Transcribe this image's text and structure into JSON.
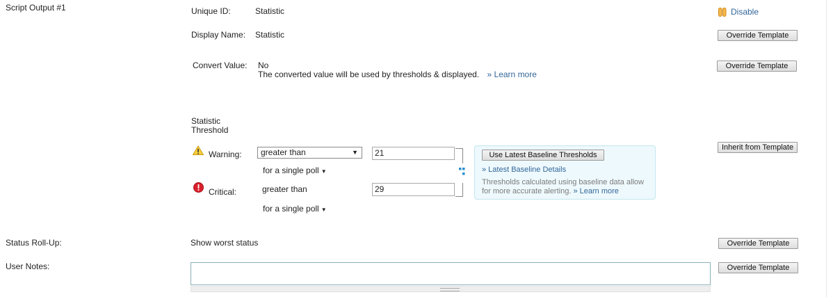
{
  "section_title": "Script Output #1",
  "unique_id": {
    "label": "Unique ID:",
    "value": "Statistic"
  },
  "display_name": {
    "label": "Display Name:",
    "value": "Statistic"
  },
  "convert_value": {
    "label": "Convert Value:",
    "value": "No",
    "description": "The converted value will be used by thresholds & displayed.",
    "learn_more": "» Learn more"
  },
  "disable_label": "Disable",
  "buttons": {
    "override_template": "Override Template",
    "inherit_from_template": "Inherit from Template",
    "use_baseline": "Use Latest Baseline Thresholds"
  },
  "threshold": {
    "title_line1": "Statistic",
    "title_line2": "Threshold",
    "warning": {
      "label": "Warning:",
      "operator": "greater than",
      "value": "21",
      "poll": "for a single poll"
    },
    "critical": {
      "label": "Critical:",
      "operator": "greater than",
      "value": "29",
      "poll": "for a single poll"
    }
  },
  "baseline": {
    "details_link": "» Latest Baseline Details",
    "info_text_line1": "Thresholds calculated using baseline data allow",
    "info_text_line2": "for more accurate alerting.",
    "learn_more": "» Learn more"
  },
  "status_rollup": {
    "label": "Status Roll-Up:",
    "value": "Show worst status"
  },
  "user_notes": {
    "label": "User Notes:",
    "value": ""
  },
  "colors": {
    "link": "#336699",
    "warning_icon": "#f2c12e",
    "critical_icon": "#d9202c",
    "baseline_box_bg": "#eef9fd",
    "baseline_box_border": "#c3e7ef",
    "disable_icon": "#f0a830"
  }
}
